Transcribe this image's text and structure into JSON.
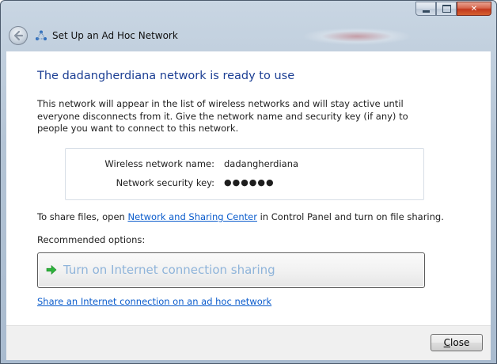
{
  "window": {
    "title": "Set Up an Ad Hoc Network",
    "minimize_glyph": "",
    "maximize_glyph": "",
    "close_glyph": "✕"
  },
  "heading": "The dadangherdiana network is ready to use",
  "description": "This network will appear in the list of wireless networks and will stay active until everyone disconnects from it. Give the network name and security key (if any) to people you want to connect to this network.",
  "network": {
    "name_label": "Wireless network name:",
    "name_value": "dadangherdiana",
    "key_label": "Network security key:",
    "key_value": "●●●●●●"
  },
  "share": {
    "prefix": "To share files, open ",
    "link": "Network and Sharing Center",
    "suffix": " in Control Panel and turn on file sharing."
  },
  "recommended_label": "Recommended options:",
  "command_link": {
    "label": "Turn on Internet connection sharing",
    "icon": "green-arrow-icon"
  },
  "adhoc_link": "Share an Internet connection on an ad hoc network",
  "footer": {
    "close_accel": "C",
    "close_rest": "lose"
  },
  "colors": {
    "heading": "#1c3f94",
    "link": "#0b5ccc",
    "command_text": "#8fb4da",
    "arrow": "#2db33b"
  }
}
